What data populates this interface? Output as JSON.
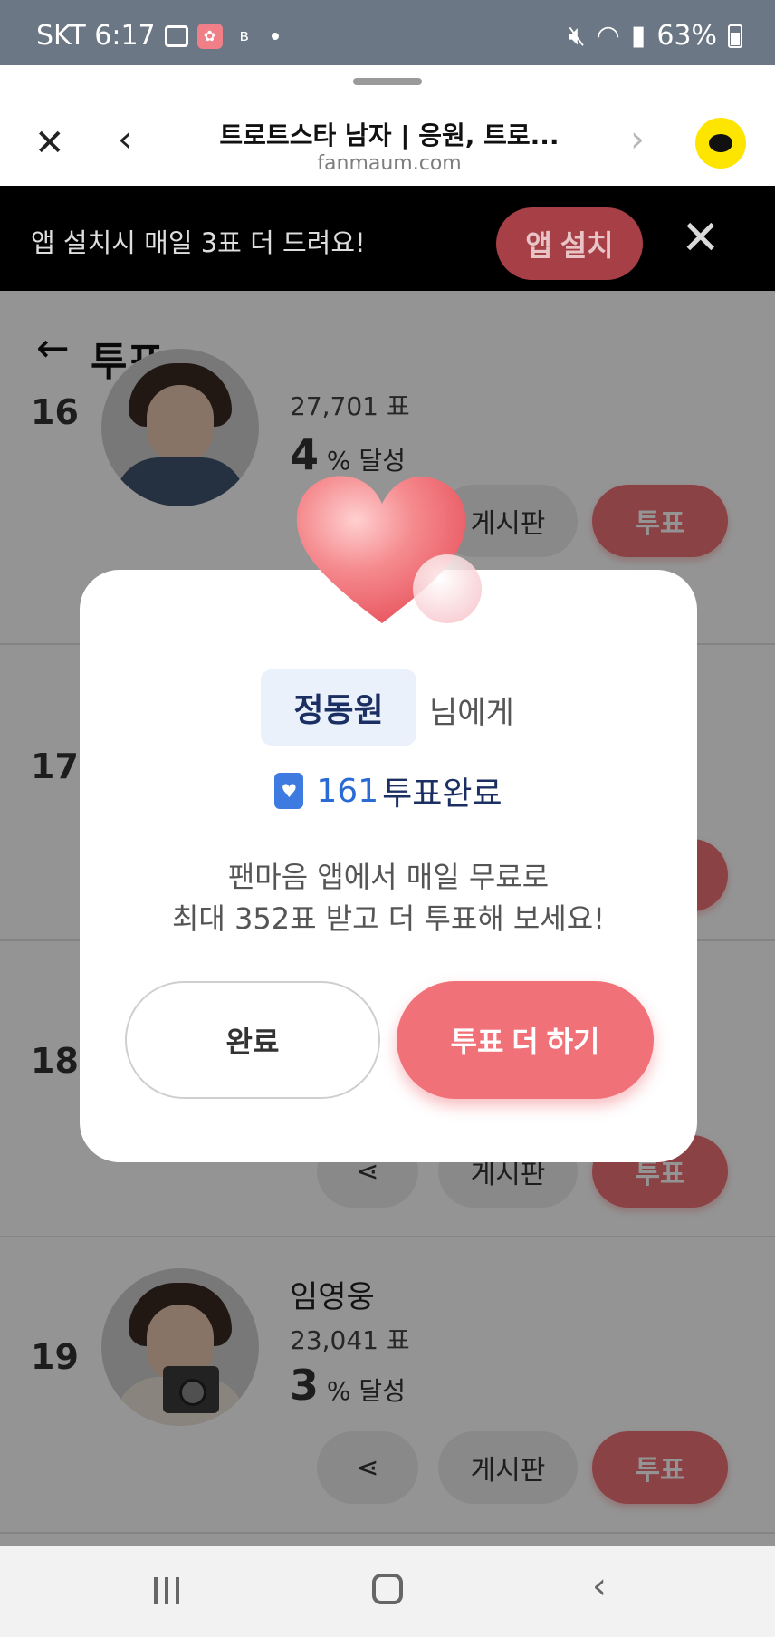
{
  "status_bar": {
    "carrier_time": "SKT 6:17",
    "battery": "63%",
    "icons": [
      "image-icon",
      "app-notification-icon",
      "b-app-icon",
      "dot-icon",
      "mute-icon",
      "wifi-icon",
      "signal-icon",
      "battery-icon"
    ]
  },
  "browser": {
    "title": "트로트스타 남자 | 응원, 트로...",
    "url": "fanmaum.com"
  },
  "banner": {
    "text": "앱 설치시 매일 3표 더 드려요!",
    "install_label": "앱 설치"
  },
  "page": {
    "title": "투표"
  },
  "rankings": [
    {
      "rank": "16",
      "name": "",
      "votes": "27,701 표",
      "pct": "4",
      "pct_unit": "% 달성"
    },
    {
      "rank": "17",
      "name": "",
      "votes": "",
      "pct": "",
      "pct_unit": ""
    },
    {
      "rank": "18",
      "name": "",
      "votes": "",
      "pct": "",
      "pct_unit": ""
    },
    {
      "rank": "19",
      "name": "임영웅",
      "votes": "23,041 표",
      "pct": "3",
      "pct_unit": "% 달성"
    }
  ],
  "buttons": {
    "board_label": "게시판",
    "vote_label": "투표"
  },
  "modal": {
    "name": "정동원",
    "name_suffix": "님에게",
    "vote_count": "161",
    "vote_done_label": "투표완료",
    "promo_line1": "팬마음 앱에서 매일 무료로",
    "promo_line2": "최대 352표 받고 더 투표해 보세요!",
    "done_label": "완료",
    "more_label": "투표 더 하기"
  },
  "colors": {
    "accent": "#f07278",
    "status_bar": "#6b7784",
    "chip_bg": "#eaf1fb",
    "vote_blue": "#2a6ad4"
  }
}
